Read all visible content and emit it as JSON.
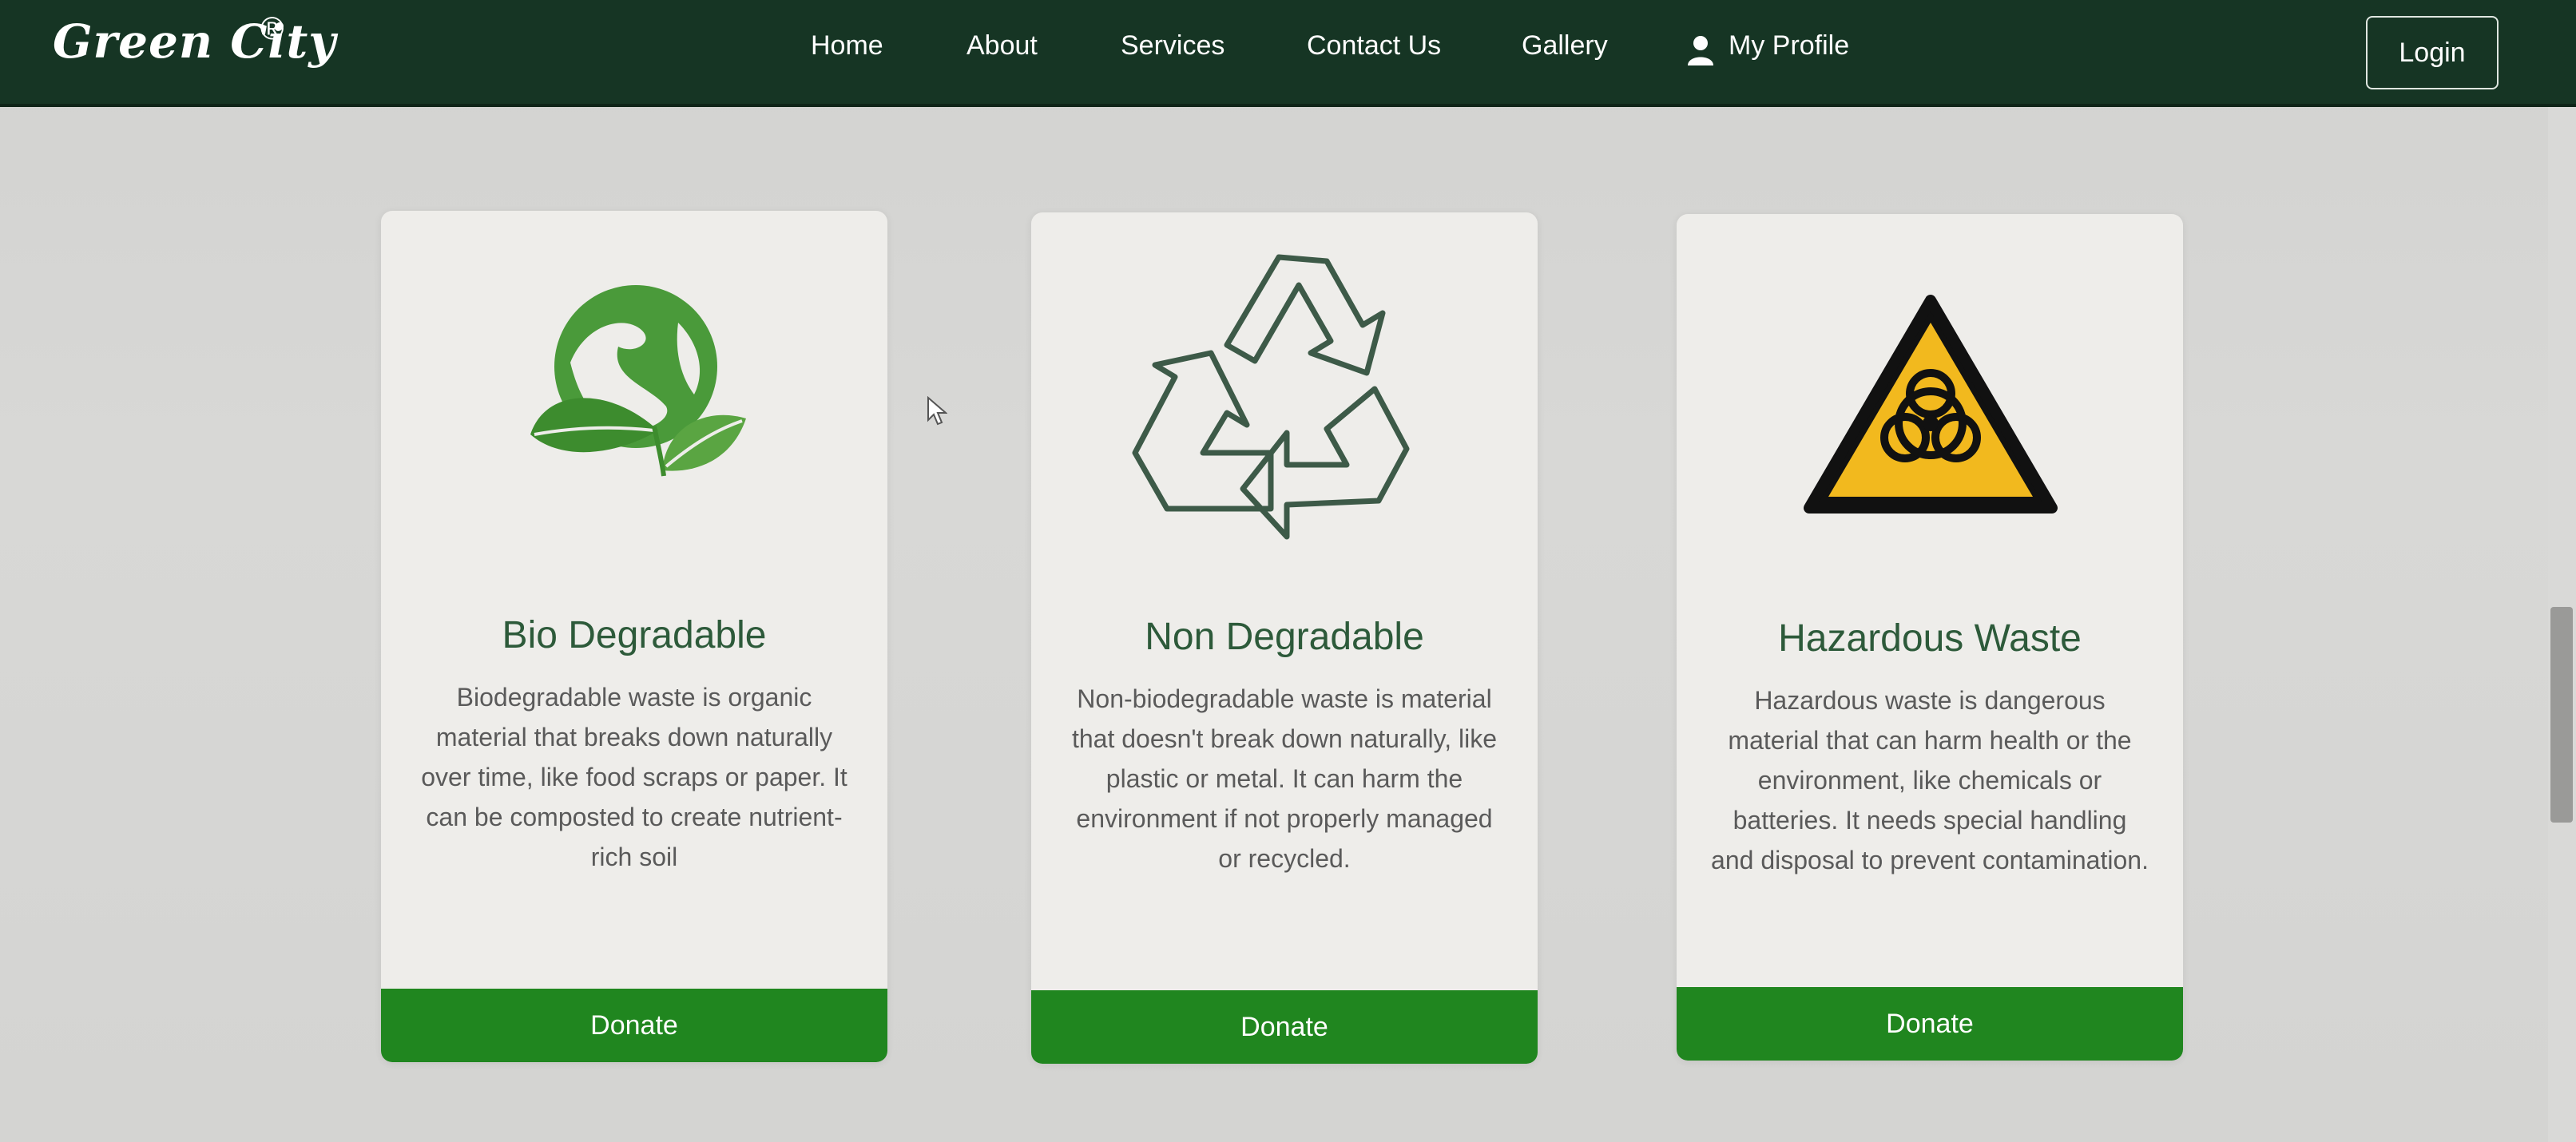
{
  "brand": {
    "name": "Green City",
    "reg": "®"
  },
  "nav": {
    "links": [
      "Home",
      "About",
      "Services",
      "Contact Us",
      "Gallery"
    ],
    "profile_label": "My Profile",
    "login_label": "Login"
  },
  "colors": {
    "navbar": "#163524",
    "card_title": "#2d5a3a",
    "donate": "#20861f",
    "hazard_yellow": "#f2b91e"
  },
  "cards": [
    {
      "title": "Bio Degradable",
      "icon": "earth-leaves-icon",
      "description": "Biodegradable waste is organic material that breaks down naturally over time, like food scraps or paper. It can be composted to create nutrient-rich soil",
      "button": "Donate"
    },
    {
      "title": "Non Degradable",
      "icon": "recycle-icon",
      "description": "Non-biodegradable waste is material that doesn't break down naturally, like plastic or metal. It can harm the environment if not properly managed or recycled.",
      "button": "Donate"
    },
    {
      "title": "Hazardous Waste",
      "icon": "biohazard-icon",
      "description": "Hazardous waste is dangerous material that can harm health or the environment, like chemicals or batteries. It needs special handling and disposal to prevent contamination.",
      "button": "Donate"
    }
  ]
}
